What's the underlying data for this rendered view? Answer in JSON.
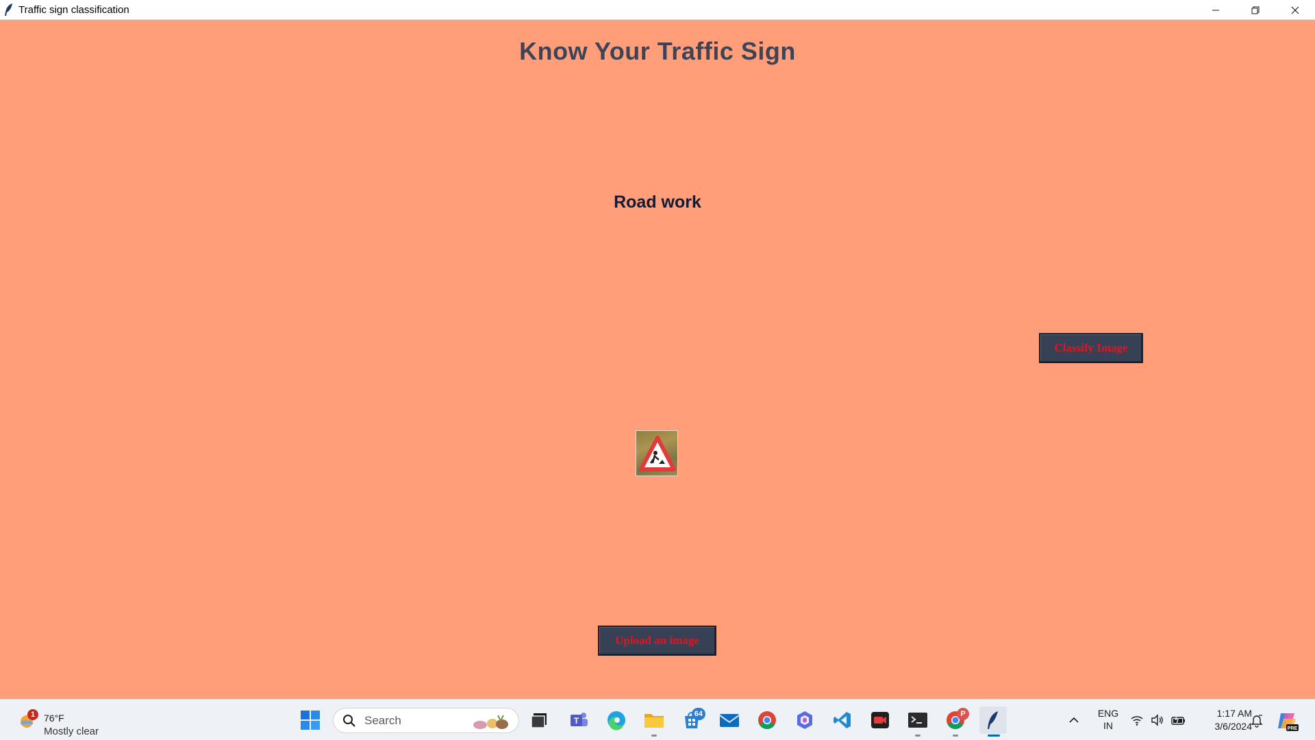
{
  "window": {
    "title": "Traffic sign classification",
    "controls": {
      "minimize": "minimize-icon",
      "restore": "restore-icon",
      "close": "close-icon"
    }
  },
  "app": {
    "background": "#ff9e79",
    "heading": "Know Your Traffic Sign",
    "result": "Road work",
    "classify_label": "Classify Image",
    "upload_label": "Upload an image",
    "button_bg": "#364156",
    "button_text_color": "#e8121d",
    "image_icon": "road-work-sign-image"
  },
  "taskbar": {
    "weather": {
      "temp": "76°F",
      "condition": "Mostly clear",
      "badge": "1"
    },
    "search_placeholder": "Search",
    "apps": [
      {
        "name": "start",
        "icon": "windows-start-icon"
      },
      {
        "name": "task-view",
        "icon": "task-view-icon"
      },
      {
        "name": "teams",
        "icon": "teams-icon"
      },
      {
        "name": "edge",
        "icon": "edge-icon"
      },
      {
        "name": "file-explorer",
        "icon": "folder-icon"
      },
      {
        "name": "store",
        "icon": "store-icon",
        "badge": "64"
      },
      {
        "name": "mail",
        "icon": "mail-icon"
      },
      {
        "name": "chrome",
        "icon": "chrome-icon"
      },
      {
        "name": "copilot-app",
        "icon": "hexagon-app-icon"
      },
      {
        "name": "vscode",
        "icon": "vscode-icon"
      },
      {
        "name": "recorder",
        "icon": "camera-app-icon"
      },
      {
        "name": "terminal",
        "icon": "terminal-icon"
      },
      {
        "name": "chrome-profile",
        "icon": "chrome-icon",
        "badge": "P"
      },
      {
        "name": "python-tk",
        "icon": "feather-icon"
      }
    ],
    "language": {
      "line1": "ENG",
      "line2": "IN"
    },
    "clock": {
      "time": "1:17 AM",
      "date": "3/6/2024"
    }
  }
}
